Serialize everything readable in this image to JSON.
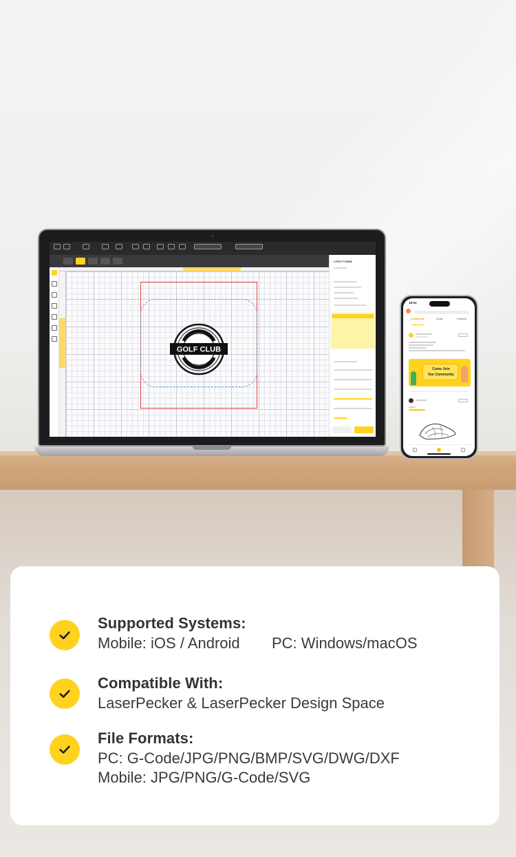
{
  "features": {
    "systems": {
      "title": "Supported Systems:",
      "mobile": "Mobile: iOS / Android",
      "pc": "PC: Windows/macOS",
      "icon": "check-circle-icon"
    },
    "compatible": {
      "title": "Compatible With:",
      "line": "LaserPecker & LaserPecker Design Space",
      "icon": "check-circle-icon"
    },
    "formats": {
      "title": "File Formats:",
      "pc": "PC: G-Code/JPG/PNG/BMP/SVG/DWG/DXF",
      "mobile": "Mobile: JPG/PNG/G-Code/SVG",
      "icon": "check-circle-icon"
    }
  },
  "laptop_app": {
    "logo_text": "GOLF CLUB",
    "logo_top_arc": "CHAMPIONSHIP",
    "logo_bottom": "ESTD 1960",
    "panel_title": "LP2D+7748DE"
  },
  "phone_app": {
    "time": "19:03",
    "tabs": [
      "Community",
      "Guide",
      "Featured"
    ],
    "banner": [
      "Come Join",
      "Our Community"
    ]
  },
  "colors": {
    "accent": "#FFD21F",
    "text_dark": "#333333",
    "card_bg": "#FFFFFF"
  }
}
